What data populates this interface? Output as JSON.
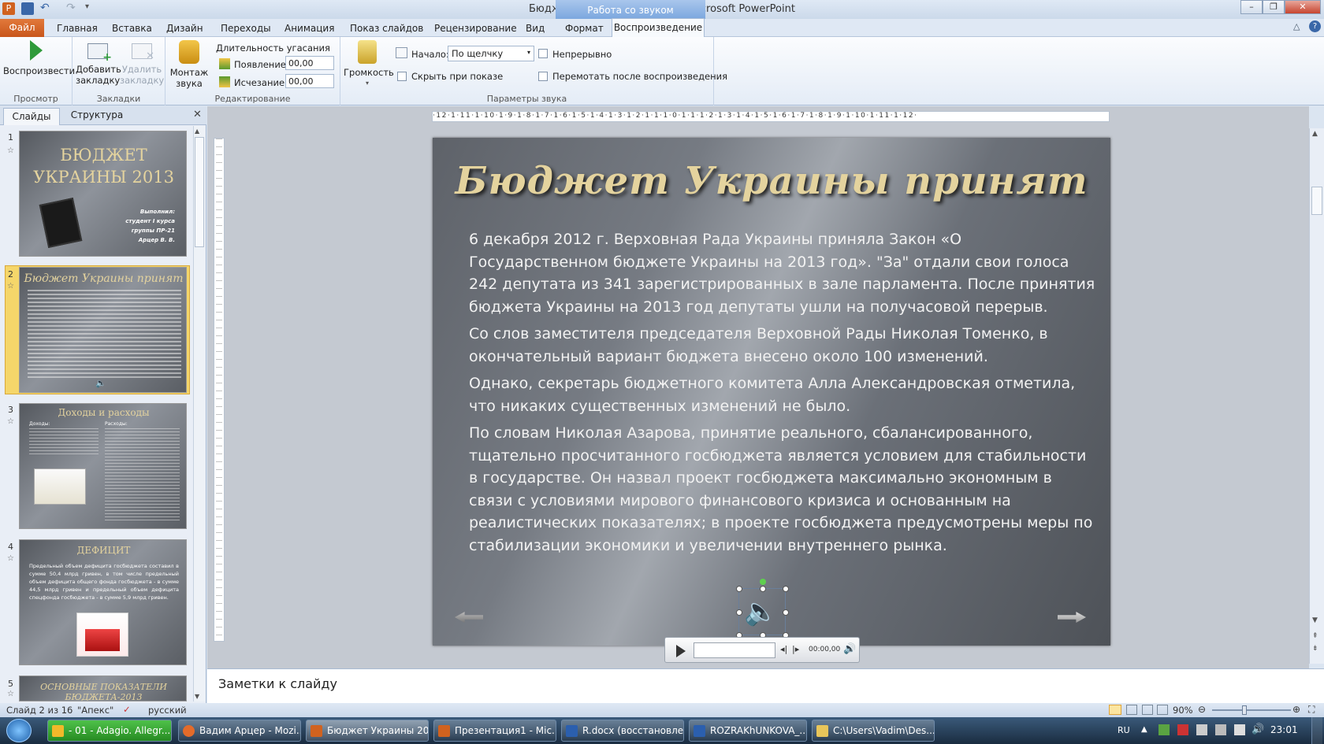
{
  "window": {
    "title": "Бюджет Украины 2013.pptx - Microsoft PowerPoint",
    "context_header": "Работа со звуком"
  },
  "tabs": {
    "file": "Файл",
    "items": [
      "Главная",
      "Вставка",
      "Дизайн",
      "Переходы",
      "Анимация",
      "Показ слайдов",
      "Рецензирование",
      "Вид",
      "Формат"
    ],
    "active": "Воспроизведение"
  },
  "ribbon": {
    "preview": {
      "play": "Воспроизвести",
      "label": "Просмотр"
    },
    "bookmarks": {
      "add1": "Добавить",
      "add2": "закладку",
      "del1": "Удалить",
      "del2": "закладку",
      "label": "Закладки"
    },
    "editing": {
      "trim1": "Монтаж",
      "trim2": "звука",
      "fade_title": "Длительность угасания",
      "fade_in_label": "Появление:",
      "fade_in_value": "00,00",
      "fade_out_label": "Исчезание:",
      "fade_out_value": "00,00",
      "label": "Редактирование"
    },
    "audio_options": {
      "volume": "Громкость",
      "start_label": "Начало:",
      "start_value": "По щелчку",
      "loop": "Непрерывно",
      "hide": "Скрыть при показе",
      "rewind": "Перемотать после воспроизведения",
      "label": "Параметры звука"
    }
  },
  "panel": {
    "tab_slides": "Слайды",
    "tab_outline": "Структура",
    "thumbs": [
      {
        "num": "1",
        "title1": "БЮДЖЕТ",
        "title2": "УКРАИНЫ 2013",
        "sub": [
          "Выполнил:",
          "студент I курса",
          "группы ПР-21",
          "Арцер В. В."
        ]
      },
      {
        "num": "2",
        "title": "Бюджет Украины принят"
      },
      {
        "num": "3",
        "title": "Доходы и расходы",
        "left_head": "Доходы:",
        "right_head": "Расходы:"
      },
      {
        "num": "4",
        "title": "ДЕФИЦИТ",
        "text": "Предельный объем дефицита госбюджета составил в сумме 50,4 млрд гривен, в том числе предельный объем дефицита общего фонда госбюджета - в сумме 44,5 млрд гривен и предельный объем дефицита спецфонда госбюджета - в сумме 5,9 млрд гривен."
      },
      {
        "num": "5",
        "title1": "ОСНОВНЫЕ ПОКАЗАТЕЛИ",
        "title2": "БЮДЖЕТА-2013"
      }
    ]
  },
  "slide": {
    "title": "Бюджет Украины принят",
    "paragraphs": [
      "6 декабря 2012 г. Верховная Рада Украины приняла Закон «О Государственном бюджете Украины на 2013 год». \"За\" отдали свои голоса 242 депутата из 341 зарегистрированных в зале парламента. После принятия бюджета Украины на 2013 год депутаты ушли на получасовой перерыв.",
      "Со слов заместителя председателя Верховной Рады Николая Томенко, в окончательный вариант бюджета внесено около 100 изменений.",
      "Однако, секретарь бюджетного комитета Алла Александровская отметила, что никаких существенных изменений не было.",
      "По словам Николая Азарова, принятие реального, сбалансированного, тщательно просчитанного госбюджета является условием для стабильности в государстве. Он назвал проект госбюджета максимально экономным в связи с условиями мирового финансового кризиса и основанным на реалистических показателях; в проекте госбюджета предусмотрены меры по стабилизации экономики и увеличении внутреннего рынка."
    ],
    "player_time": "00:00,00"
  },
  "ruler": {
    "h_labels": "·12·1·11·1·10·1·9·1·8·1·7·1·6·1·5·1·4·1·3·1·2·1·1·1·0·1·1·1·2·1·3·1·4·1·5·1·6·1·7·1·8·1·9·1·10·1·11·1·12·"
  },
  "notes": {
    "placeholder": "Заметки к слайду"
  },
  "status": {
    "slide": "Слайд 2 из 16",
    "theme": "\"Апекс\"",
    "lang": "русский",
    "zoom": "90%"
  },
  "taskbar": {
    "items": [
      "- 01 - Adagio. Allegr...",
      "Вадим Арцер - Mozi...",
      "Бюджет Украины 20...",
      "Презентация1 - Mic...",
      "R.docx (восстановле...",
      "ROZRAKhUNKOVA_...",
      "C:\\Users\\Vadim\\Des..."
    ],
    "lang": "RU",
    "time": "23:01"
  },
  "colors": {
    "file_tab": "#d0621f",
    "slide_title": "#e4d39e",
    "taskbar": "#1f3349",
    "selected_thumb": "#f5d66a"
  }
}
